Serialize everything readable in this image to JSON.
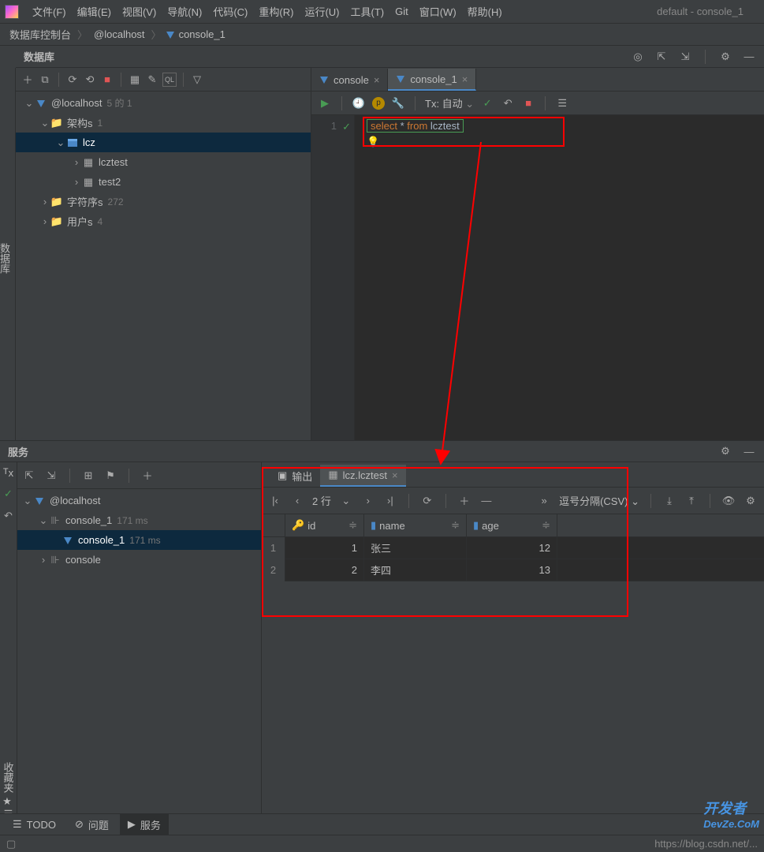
{
  "title": "default - console_1",
  "menu": [
    "文件(F)",
    "编辑(E)",
    "视图(V)",
    "导航(N)",
    "代码(C)",
    "重构(R)",
    "运行(U)",
    "工具(T)",
    "Git",
    "窗口(W)",
    "帮助(H)"
  ],
  "breadcrumb": {
    "a": "数据库控制台",
    "b": "@localhost",
    "c": "console_1"
  },
  "db_panel": {
    "title": "数据库"
  },
  "tree": {
    "root": "@localhost",
    "root_badge": "5 的 1",
    "schemas": "架构s",
    "schemas_badge": "1",
    "schema": "lcz",
    "t1": "lcztest",
    "t2": "test2",
    "chars": "字符序s",
    "chars_badge": "272",
    "users": "用户s",
    "users_badge": "4"
  },
  "tabs": {
    "t1": "console",
    "t2": "console_1"
  },
  "editor_toolbar": {
    "tx": "Tx: 自动"
  },
  "code": {
    "line": "1",
    "sql_select": "select",
    "sql_star": "*",
    "sql_from": "from",
    "sql_table": "lcztest"
  },
  "services": {
    "title": "服务",
    "tree_root": "@localhost",
    "c1": "console_1",
    "c1_time": "171 ms",
    "c2": "console_1",
    "c2_time": "171 ms",
    "c3": "console",
    "output_tab": "输出",
    "result_tab": "lcz.lcztest",
    "rows_label": "2 行",
    "csv": "逗号分隔(CSV)",
    "columns": {
      "id": "id",
      "name": "name",
      "age": "age"
    },
    "data": [
      {
        "n": "1",
        "id": "1",
        "name": "张三",
        "age": "12"
      },
      {
        "n": "2",
        "id": "2",
        "name": "李四",
        "age": "13"
      }
    ]
  },
  "bottom": {
    "todo": "TODO",
    "problems": "问题",
    "services": "服务"
  },
  "status_url": "https://blog.csdn.net/...",
  "fav": "收藏夹",
  "sidebar_label": "数据库",
  "watermark": "DevZe.CoM",
  "watermark2": "开发者"
}
